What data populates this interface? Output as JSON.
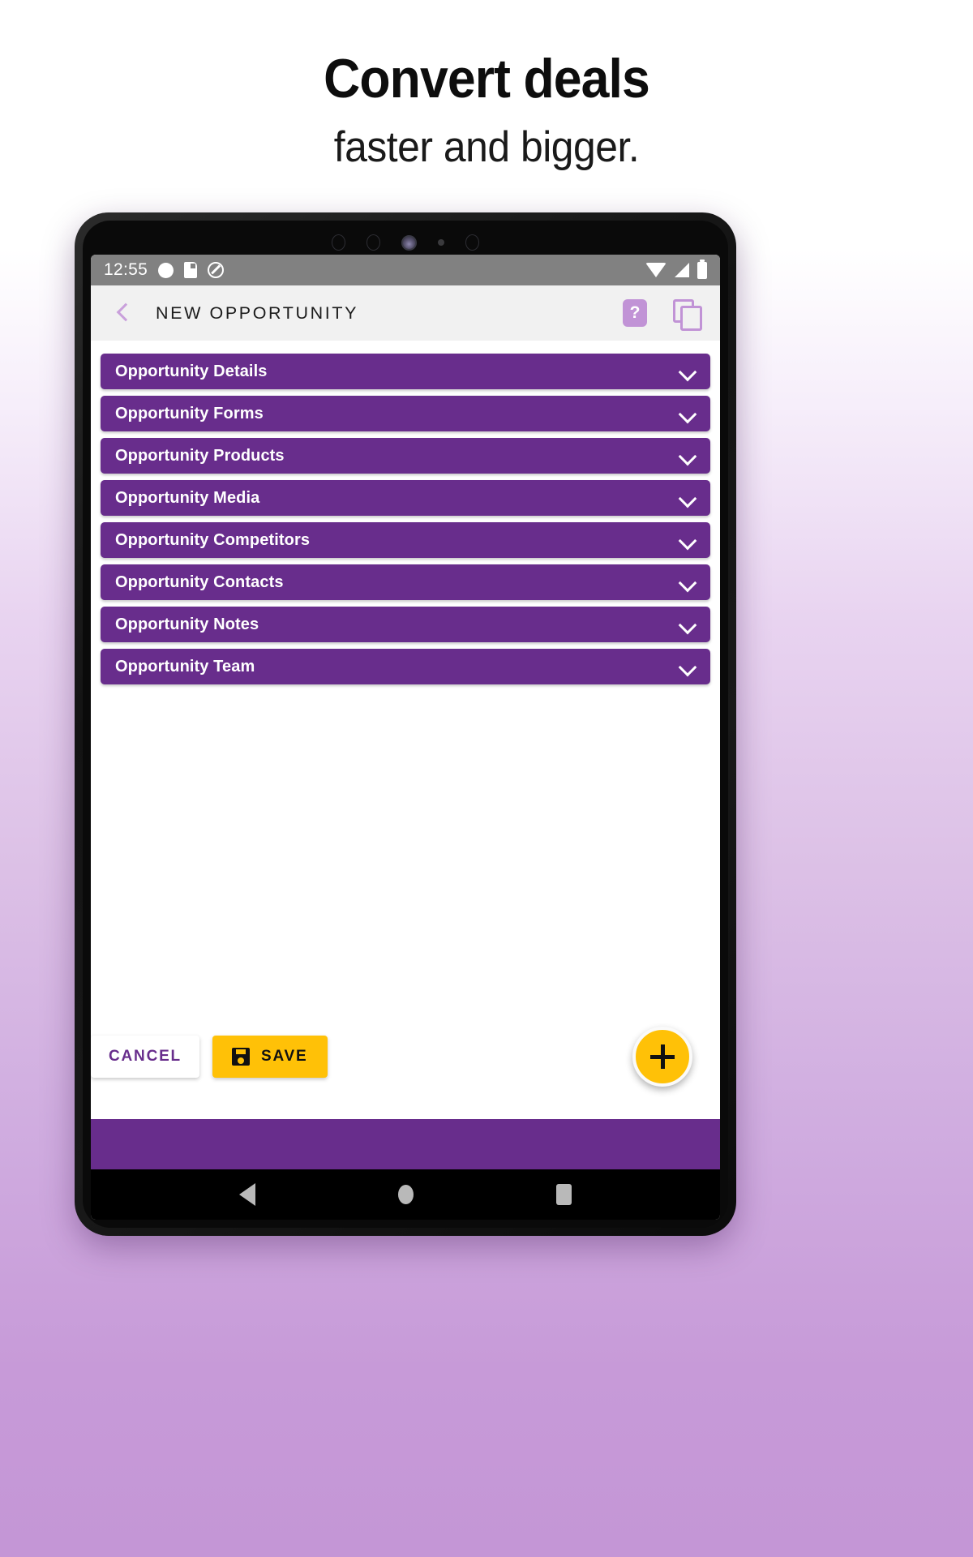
{
  "promo": {
    "title": "Convert deals",
    "subtitle": "faster and bigger."
  },
  "colors": {
    "primary_purple": "#682d8c",
    "accent_yellow": "#ffc107",
    "light_purple": "#c193d6",
    "bg_gradient_bottom": "#c79ad8"
  },
  "statusbar": {
    "time": "12:55",
    "left_icons": [
      "recording-dot-icon",
      "sd-card-icon",
      "do-not-disturb-icon"
    ],
    "right_icons": [
      "wifi-icon",
      "cellular-signal-icon",
      "battery-full-icon"
    ]
  },
  "appbar": {
    "back_icon": "back-chevron-icon",
    "title": "NEW OPPORTUNITY",
    "help_label": "?",
    "copy_icon": "copy-icon"
  },
  "sections": [
    {
      "label": "Opportunity Details"
    },
    {
      "label": "Opportunity Forms"
    },
    {
      "label": "Opportunity Products"
    },
    {
      "label": "Opportunity Media"
    },
    {
      "label": "Opportunity Competitors"
    },
    {
      "label": "Opportunity Contacts"
    },
    {
      "label": "Opportunity Notes"
    },
    {
      "label": "Opportunity Team"
    }
  ],
  "actions": {
    "cancel_label": "CANCEL",
    "save_label": "SAVE",
    "save_icon": "floppy-disk-save-icon",
    "fab_icon": "plus-icon"
  },
  "navbar": {
    "back": "triangle-back-icon",
    "home": "circle-home-icon",
    "recents": "square-recents-icon"
  }
}
